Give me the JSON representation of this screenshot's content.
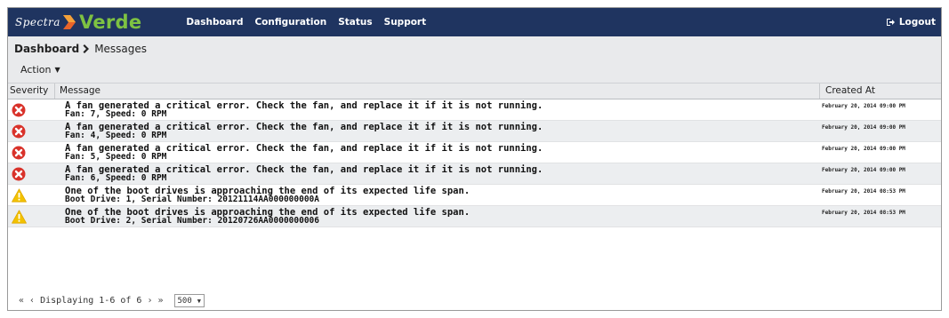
{
  "brand": {
    "spectra": "Spectra",
    "verde": "Verde"
  },
  "nav": {
    "items": [
      "Dashboard",
      "Configuration",
      "Status",
      "Support"
    ],
    "logout": "Logout"
  },
  "breadcrumb": {
    "root": "Dashboard",
    "current": "Messages"
  },
  "action_label": "Action",
  "table": {
    "headers": {
      "severity": "Severity",
      "message": "Message",
      "created": "Created At"
    },
    "rows": [
      {
        "severity": "error",
        "line1": "A fan generated a critical error. Check the fan, and replace it if it is not running.",
        "line2": "Fan: 7, Speed: 0 RPM",
        "created": "February 20, 2014 09:00 PM"
      },
      {
        "severity": "error",
        "line1": "A fan generated a critical error. Check the fan, and replace it if it is not running.",
        "line2": "Fan: 4, Speed: 0 RPM",
        "created": "February 20, 2014 09:00 PM"
      },
      {
        "severity": "error",
        "line1": "A fan generated a critical error. Check the fan, and replace it if it is not running.",
        "line2": "Fan: 5, Speed: 0 RPM",
        "created": "February 20, 2014 09:00 PM"
      },
      {
        "severity": "error",
        "line1": "A fan generated a critical error. Check the fan, and replace it if it is not running.",
        "line2": "Fan: 6, Speed: 0 RPM",
        "created": "February 20, 2014 09:00 PM"
      },
      {
        "severity": "warning",
        "line1": "One of the boot drives is approaching the end of its expected life span.",
        "line2": "Boot Drive: 1, Serial Number: 20121114AA000000000A",
        "created": "February 20, 2014 08:53 PM"
      },
      {
        "severity": "warning",
        "line1": "One of the boot drives is approaching the end of its expected life span.",
        "line2": "Boot Drive: 2, Serial Number: 20120726AA0000000006",
        "created": "February 20, 2014 08:53 PM"
      }
    ]
  },
  "pagination": {
    "first": "«",
    "prev": "‹",
    "text": "Displaying 1-6 of 6",
    "next": "›",
    "last": "»",
    "page_size": "500"
  },
  "colors": {
    "nav_bg": "#1f3460",
    "brand_green": "#7ec242",
    "error_red": "#d9322a",
    "warning_yellow": "#f2c200"
  },
  "icons": {
    "error": "error-icon",
    "warning": "warning-icon",
    "logout": "logout-icon"
  }
}
